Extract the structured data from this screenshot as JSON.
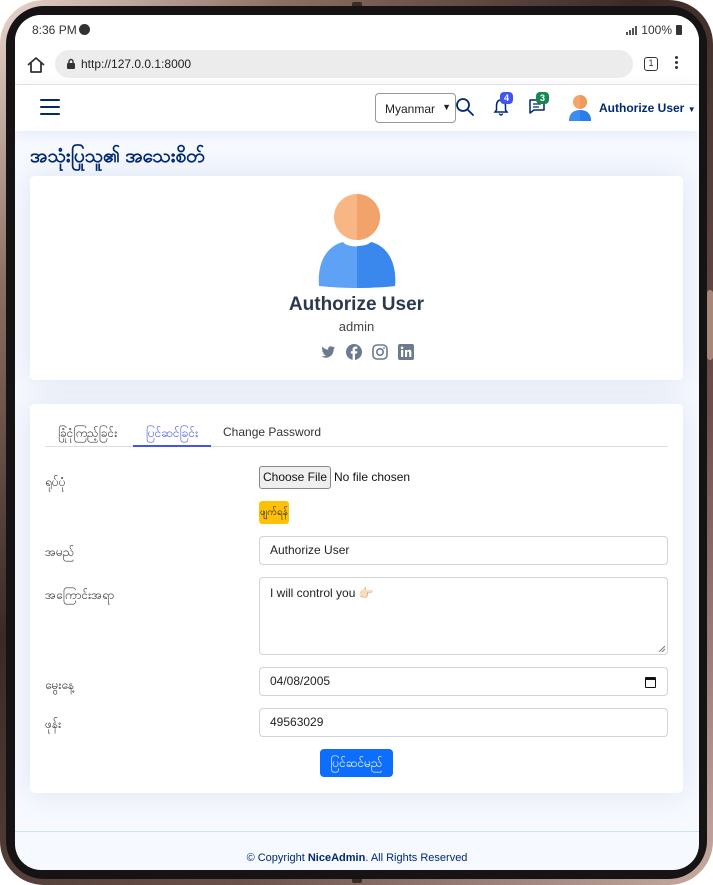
{
  "status": {
    "time": "8:36 PM",
    "battery": "100%"
  },
  "browser": {
    "url": "http://127.0.0.1:8000",
    "tab_count": "1"
  },
  "header": {
    "language": "Myanmar",
    "notifications_count": "4",
    "messages_count": "3",
    "user_name": "Authorize User"
  },
  "page": {
    "title": "အသုံးပြုသူ၏ အသေးစိတ်"
  },
  "profile": {
    "name": "Authorize User",
    "role": "admin",
    "socials": [
      "twitter-icon",
      "facebook-icon",
      "instagram-icon",
      "linkedin-icon"
    ]
  },
  "tabs": [
    {
      "label": "ခြုံငုံကြည့်ခြင်း"
    },
    {
      "label": "ပြင်ဆင်ခြင်း"
    },
    {
      "label": "Change Password"
    }
  ],
  "form": {
    "photo_label": "ရုပ်ပုံ",
    "choose_file": "Choose File",
    "no_file": "No file chosen",
    "delete_label": "ဖျက်ရန်",
    "name_label": "အမည်",
    "name_value": "Authorize User",
    "about_label": "အကြောင်းအရာ",
    "about_value": "I will control you 👉🏻",
    "birthday_label": "မွေးနေ့",
    "birthday_value": "04/08/2005",
    "phone_label": "ဖုန်း",
    "phone_value": "49563029",
    "submit_label": "ပြင်ဆင်မည်"
  },
  "footer": {
    "prefix": "© Copyright ",
    "brand": "NiceAdmin",
    "suffix": ". All Rights Reserved"
  },
  "colors": {
    "brand_navy": "#012970",
    "primary": "#0d6efd",
    "accent": "#4154f1",
    "warning": "#ffc107"
  }
}
